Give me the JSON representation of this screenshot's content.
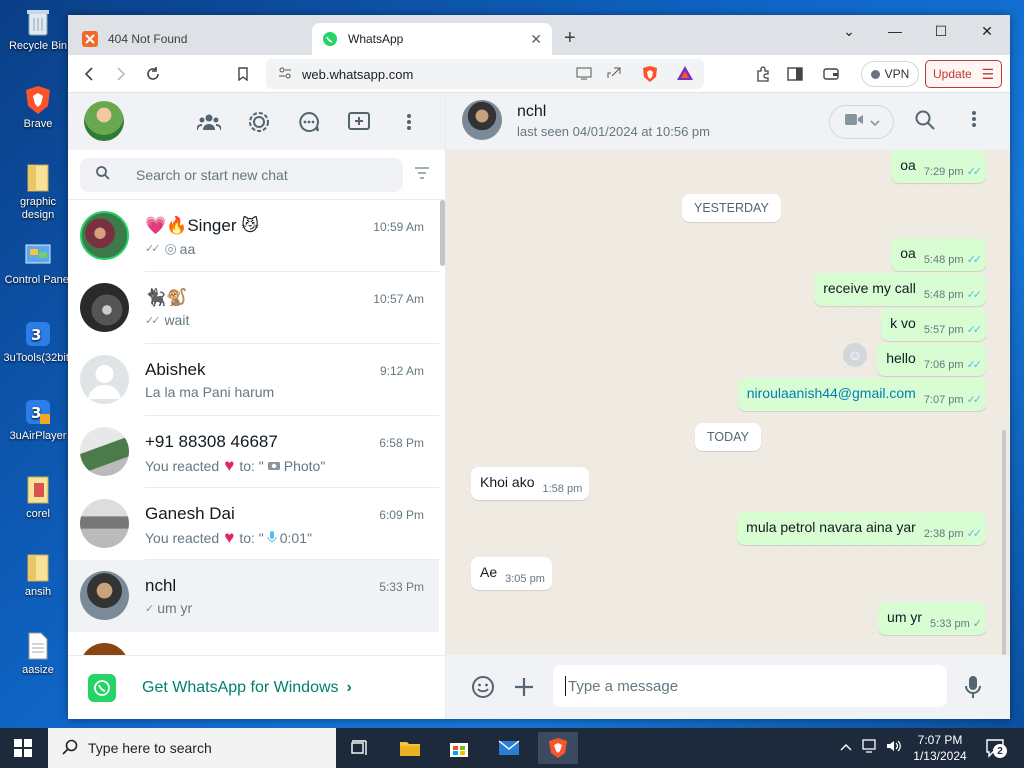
{
  "desktop": {
    "icons": [
      {
        "label": "Recycle Bin",
        "icon": "recycle-bin-icon"
      },
      {
        "label": "Brave",
        "icon": "brave-icon"
      },
      {
        "label": "graphic design",
        "icon": "folder-icon"
      },
      {
        "label": "Control Panel",
        "icon": "control-panel-icon"
      },
      {
        "label": "3uTools(32bit)",
        "icon": "3utools-icon"
      },
      {
        "label": "3uAirPlayer",
        "icon": "3uairplayer-icon"
      },
      {
        "label": "corel",
        "icon": "folder-icon"
      },
      {
        "label": "ansih",
        "icon": "folder-icon"
      },
      {
        "label": "aasize",
        "icon": "file-icon"
      }
    ]
  },
  "browser": {
    "tabs": [
      {
        "title": "404 Not Found",
        "active": false
      },
      {
        "title": "WhatsApp",
        "active": true
      }
    ],
    "url": "web.whatsapp.com",
    "vpn_label": "VPN",
    "update_label": "Update"
  },
  "whatsapp": {
    "search_placeholder": "Search or start new chat",
    "chats": [
      {
        "name": "💗🔥Singer 😼",
        "time": "10:59 Am",
        "preview": "aa",
        "status": "read"
      },
      {
        "name": "🐈‍⬛🐒",
        "time": "10:57 Am",
        "preview": "wait",
        "status": "read"
      },
      {
        "name": "Abishek",
        "time": "9:12 Am",
        "preview": "La la ma Pani harum",
        "status": "none"
      },
      {
        "name": "+91 88308 46687",
        "time": "6:58 Pm",
        "preview_prefix": "You reacted",
        "preview_suffix": "to: \"",
        "preview_media": "Photo\"",
        "status": "reaction"
      },
      {
        "name": "Ganesh Dai",
        "time": "6:09 Pm",
        "preview_prefix": "You reacted",
        "preview_suffix": "to: \"",
        "preview_media": "0:01\"",
        "status": "reaction"
      },
      {
        "name": "nchl",
        "time": "5:33 Pm",
        "preview": "um yr",
        "status": "sent",
        "selected": true
      }
    ],
    "get_app_label": "Get WhatsApp for Windows",
    "conversation": {
      "contact_name": "nchl",
      "last_seen": "last seen 04/01/2024 at 10:56 pm",
      "date_yesterday": "YESTERDAY",
      "date_today": "TODAY",
      "messages": [
        {
          "dir": "out",
          "text": "oa",
          "time": "7:29 pm"
        },
        {
          "dir": "out",
          "text": "oa",
          "time": "5:48 pm"
        },
        {
          "dir": "out",
          "text": "receive my call",
          "time": "5:48 pm"
        },
        {
          "dir": "out",
          "text": "k vo",
          "time": "5:57 pm"
        },
        {
          "dir": "out",
          "text": "hello",
          "time": "7:06 pm"
        },
        {
          "dir": "out",
          "text": "niroulaanish44@gmail.com",
          "time": "7:07 pm"
        },
        {
          "dir": "in",
          "text": "Khoi ako",
          "time": "1:58 pm"
        },
        {
          "dir": "out",
          "text": "mula petrol navara aina yar",
          "time": "2:38 pm"
        },
        {
          "dir": "in",
          "text": "Ae",
          "time": "3:05 pm"
        },
        {
          "dir": "out",
          "text": "um yr",
          "time": "5:33 pm"
        }
      ],
      "input_placeholder": "Type a message"
    }
  },
  "taskbar": {
    "search_placeholder": "Type here to search",
    "time": "7:07 PM",
    "date": "1/13/2024",
    "notification_count": "2"
  },
  "colors": {
    "accent": "#008069",
    "outgoing_bubble": "#d9fdd3",
    "read_tick": "#53bdeb",
    "brave": "#fb542b"
  }
}
